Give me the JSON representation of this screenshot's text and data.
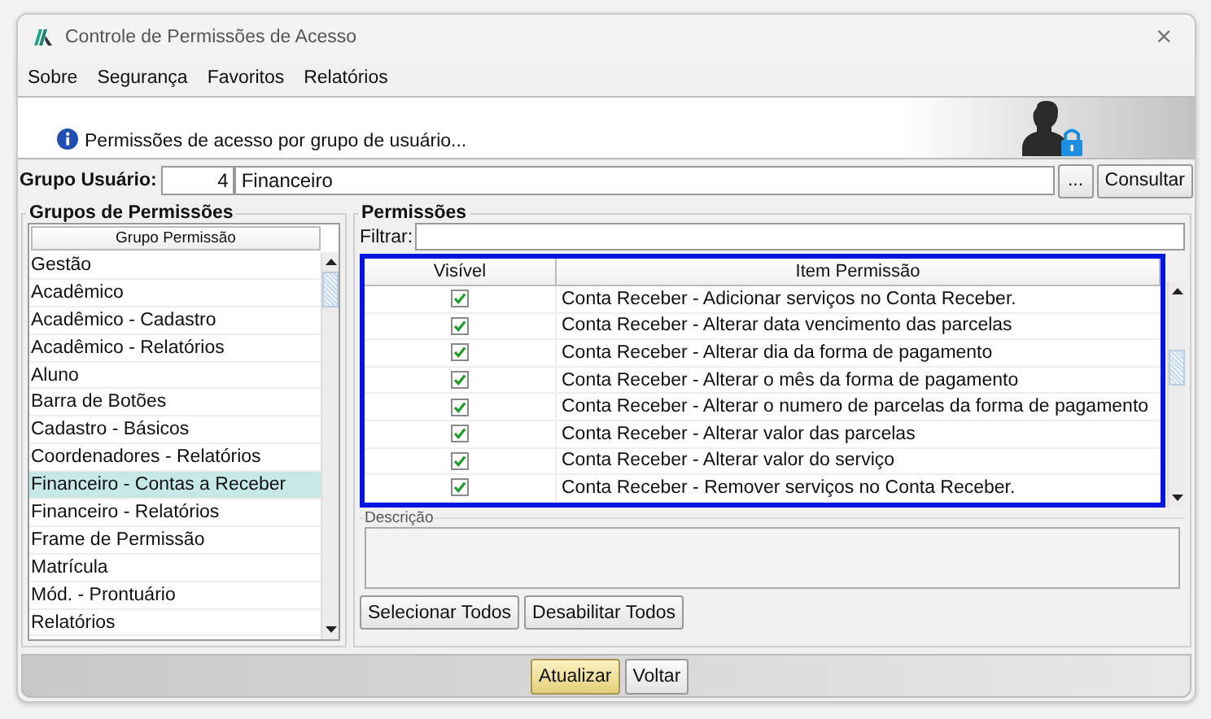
{
  "window": {
    "title": "Controle de Permissões de Acesso",
    "close": "×"
  },
  "menu": [
    {
      "label": "Sobre"
    },
    {
      "label": "Segurança"
    },
    {
      "label": "Favoritos"
    },
    {
      "label": "Relatórios"
    }
  ],
  "banner": {
    "text": "Permissões de acesso por grupo de usuário..."
  },
  "user_group": {
    "label": "Grupo Usuário:",
    "code": "4",
    "name": "Financeiro",
    "browse": "...",
    "button": "Consultar"
  },
  "groups_panel": {
    "title": "Grupos de Permissões",
    "column": "Grupo Permissão",
    "items": [
      {
        "label": "Gestão",
        "selected": false
      },
      {
        "label": "Acadêmico",
        "selected": false
      },
      {
        "label": "Acadêmico - Cadastro",
        "selected": false
      },
      {
        "label": "Acadêmico - Relatórios",
        "selected": false
      },
      {
        "label": "Aluno",
        "selected": false
      },
      {
        "label": "Barra de Botões",
        "selected": false
      },
      {
        "label": "Cadastro - Básicos",
        "selected": false
      },
      {
        "label": "Coordenadores - Relatórios",
        "selected": false
      },
      {
        "label": "Financeiro - Contas a Receber",
        "selected": true
      },
      {
        "label": "Financeiro - Relatórios",
        "selected": false
      },
      {
        "label": "Frame de Permissão",
        "selected": false
      },
      {
        "label": "Matrícula",
        "selected": false
      },
      {
        "label": "Mód. - Prontuário",
        "selected": false
      },
      {
        "label": "Relatórios",
        "selected": false
      }
    ]
  },
  "permissions_panel": {
    "title": "Permissões",
    "filter_label": "Filtrar:",
    "columns": [
      "Visível",
      "Item Permissão"
    ],
    "rows": [
      {
        "visible": true,
        "item": "Conta Receber - Adicionar serviços no Conta Receber."
      },
      {
        "visible": true,
        "item": "Conta Receber - Alterar data vencimento das parcelas"
      },
      {
        "visible": true,
        "item": "Conta Receber - Alterar dia da forma de pagamento"
      },
      {
        "visible": true,
        "item": "Conta Receber - Alterar o mês da forma de pagamento"
      },
      {
        "visible": true,
        "item": "Conta Receber - Alterar o numero de parcelas da forma de pagamento"
      },
      {
        "visible": true,
        "item": "Conta Receber - Alterar valor das parcelas"
      },
      {
        "visible": true,
        "item": "Conta Receber - Alterar valor do serviço"
      },
      {
        "visible": true,
        "item": "Conta Receber - Remover serviços no Conta Receber."
      }
    ],
    "description_label": "Descrição",
    "buttons": [
      "Selecionar Todos",
      "Desabilitar Todos"
    ]
  },
  "footer": {
    "buttons": [
      {
        "label": "Atualizar",
        "kind": "primary"
      },
      {
        "label": "Voltar",
        "kind": "normal"
      }
    ]
  }
}
